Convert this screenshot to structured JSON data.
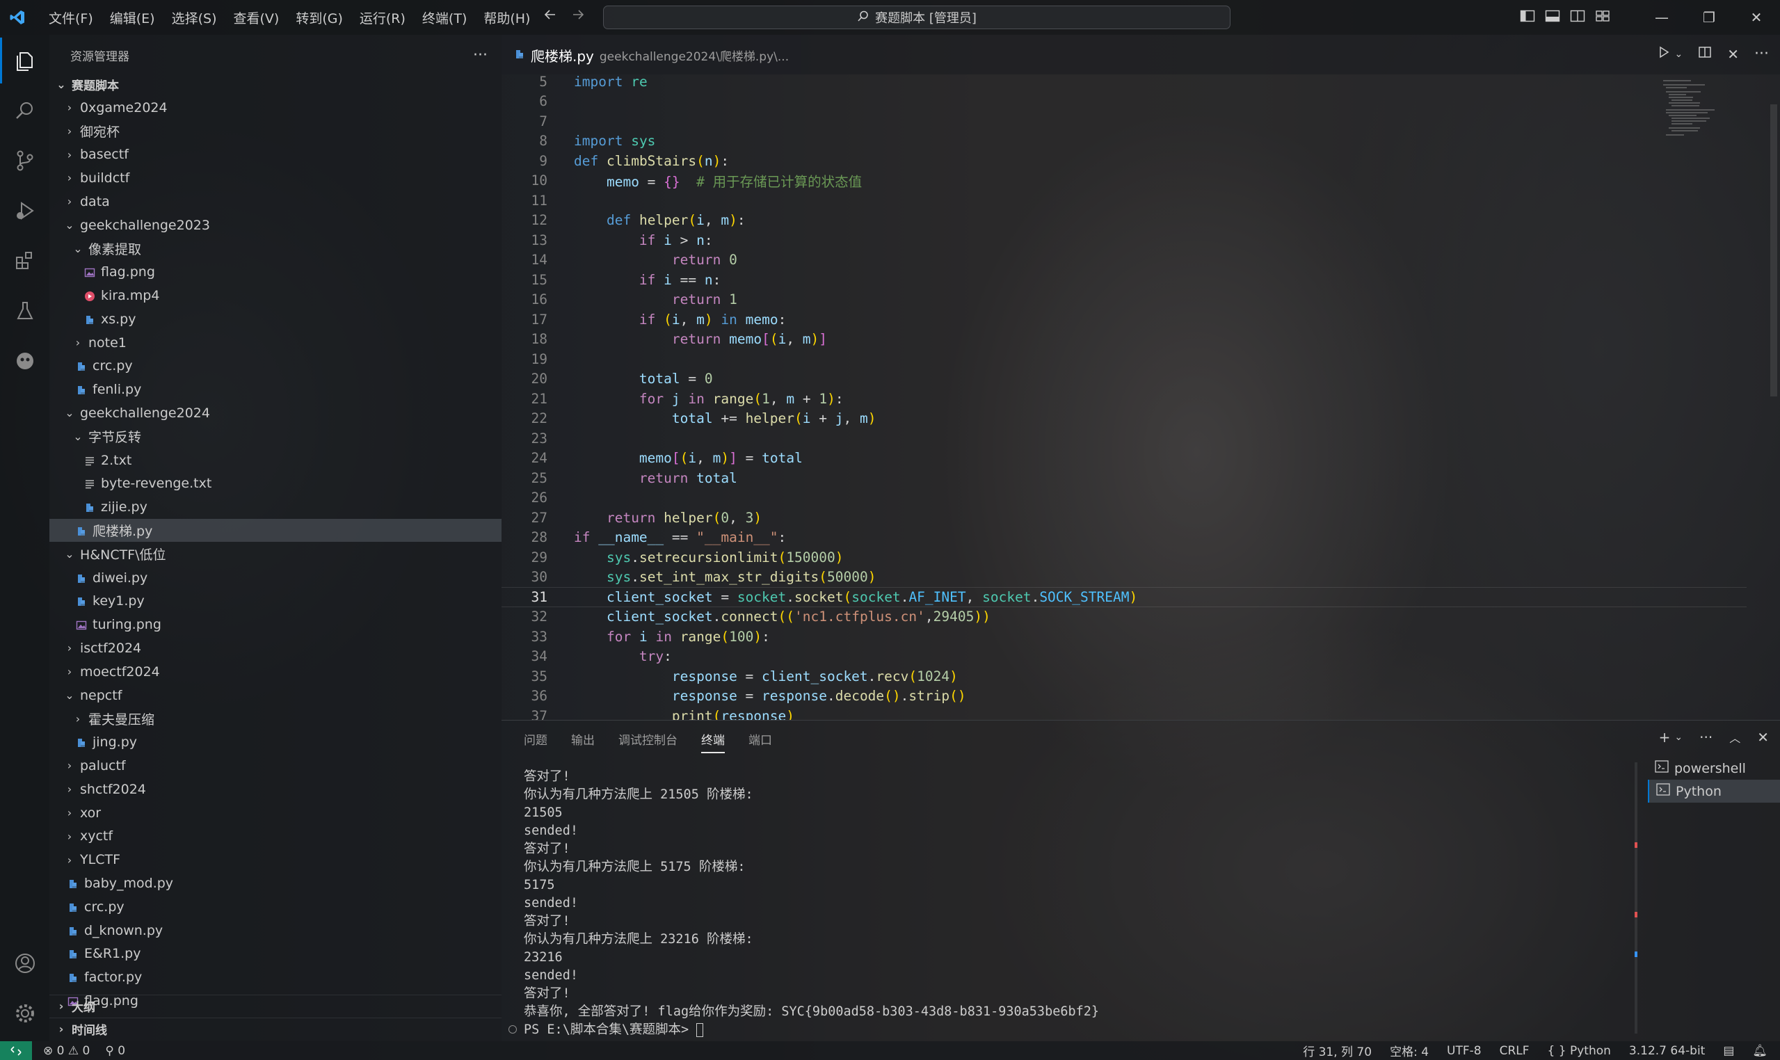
{
  "menu": [
    "文件(F)",
    "编辑(E)",
    "选择(S)",
    "查看(V)",
    "转到(G)",
    "运行(R)",
    "终端(T)",
    "帮助(H)"
  ],
  "command_center": "赛题脚本 [管理员]",
  "explorer": {
    "title": "资源管理器",
    "root": "赛题脚本",
    "rows": [
      {
        "label": "0xgame2024",
        "depth": 1,
        "kind": "folder"
      },
      {
        "label": "御宛杯",
        "depth": 1,
        "kind": "folder"
      },
      {
        "label": "basectf",
        "depth": 1,
        "kind": "folder"
      },
      {
        "label": "buildctf",
        "depth": 1,
        "kind": "folder"
      },
      {
        "label": "data",
        "depth": 1,
        "kind": "folder"
      },
      {
        "label": "geekchallenge2023",
        "depth": 1,
        "kind": "folder-open"
      },
      {
        "label": "像素提取",
        "depth": 2,
        "kind": "folder-open"
      },
      {
        "label": "flag.png",
        "depth": 3,
        "kind": "image"
      },
      {
        "label": "kira.mp4",
        "depth": 3,
        "kind": "video"
      },
      {
        "label": "xs.py",
        "depth": 3,
        "kind": "python"
      },
      {
        "label": "note1",
        "depth": 2,
        "kind": "folder"
      },
      {
        "label": "crc.py",
        "depth": 2,
        "kind": "python"
      },
      {
        "label": "fenli.py",
        "depth": 2,
        "kind": "python"
      },
      {
        "label": "geekchallenge2024",
        "depth": 1,
        "kind": "folder-open"
      },
      {
        "label": "字节反转",
        "depth": 2,
        "kind": "folder-open"
      },
      {
        "label": "2.txt",
        "depth": 3,
        "kind": "text"
      },
      {
        "label": "byte-revenge.txt",
        "depth": 3,
        "kind": "text"
      },
      {
        "label": "zijie.py",
        "depth": 3,
        "kind": "python"
      },
      {
        "label": "爬楼梯.py",
        "depth": 2,
        "kind": "python",
        "selected": true
      },
      {
        "label": "H&NCTF\\低位",
        "depth": 1,
        "kind": "folder-open"
      },
      {
        "label": "diwei.py",
        "depth": 2,
        "kind": "python"
      },
      {
        "label": "key1.py",
        "depth": 2,
        "kind": "python"
      },
      {
        "label": "turing.png",
        "depth": 2,
        "kind": "image"
      },
      {
        "label": "isctf2024",
        "depth": 1,
        "kind": "folder"
      },
      {
        "label": "moectf2024",
        "depth": 1,
        "kind": "folder"
      },
      {
        "label": "nepctf",
        "depth": 1,
        "kind": "folder-open"
      },
      {
        "label": "霍夫曼压缩",
        "depth": 2,
        "kind": "folder"
      },
      {
        "label": "jing.py",
        "depth": 2,
        "kind": "python"
      },
      {
        "label": "paluctf",
        "depth": 1,
        "kind": "folder"
      },
      {
        "label": "shctf2024",
        "depth": 1,
        "kind": "folder"
      },
      {
        "label": "xor",
        "depth": 1,
        "kind": "folder"
      },
      {
        "label": "xyctf",
        "depth": 1,
        "kind": "folder"
      },
      {
        "label": "YLCTF",
        "depth": 1,
        "kind": "folder"
      },
      {
        "label": "baby_mod.py",
        "depth": 1,
        "kind": "python"
      },
      {
        "label": "crc.py",
        "depth": 1,
        "kind": "python"
      },
      {
        "label": "d_known.py",
        "depth": 1,
        "kind": "python"
      },
      {
        "label": "E&R1.py",
        "depth": 1,
        "kind": "python"
      },
      {
        "label": "factor.py",
        "depth": 1,
        "kind": "python"
      },
      {
        "label": "flag.png",
        "depth": 1,
        "kind": "image"
      }
    ],
    "sections": [
      "大纲",
      "时间线"
    ]
  },
  "tab": {
    "name": "爬楼梯.py",
    "path": "geekchallenge2024\\爬楼梯.py\\..."
  },
  "code": {
    "current_line": 31,
    "lines": [
      {
        "n": 5,
        "t": "import re"
      },
      {
        "n": 6,
        "t": ""
      },
      {
        "n": 7,
        "t": ""
      },
      {
        "n": 8,
        "t": "import sys"
      },
      {
        "n": 9,
        "t": "def climbStairs(n):"
      },
      {
        "n": 10,
        "t": "    memo = {}  # 用于存储已计算的状态值"
      },
      {
        "n": 11,
        "t": ""
      },
      {
        "n": 12,
        "t": "    def helper(i, m):"
      },
      {
        "n": 13,
        "t": "        if i > n:"
      },
      {
        "n": 14,
        "t": "            return 0"
      },
      {
        "n": 15,
        "t": "        if i == n:"
      },
      {
        "n": 16,
        "t": "            return 1"
      },
      {
        "n": 17,
        "t": "        if (i, m) in memo:"
      },
      {
        "n": 18,
        "t": "            return memo[(i, m)]"
      },
      {
        "n": 19,
        "t": ""
      },
      {
        "n": 20,
        "t": "        total = 0"
      },
      {
        "n": 21,
        "t": "        for j in range(1, m + 1):"
      },
      {
        "n": 22,
        "t": "            total += helper(i + j, m)"
      },
      {
        "n": 23,
        "t": ""
      },
      {
        "n": 24,
        "t": "        memo[(i, m)] = total"
      },
      {
        "n": 25,
        "t": "        return total"
      },
      {
        "n": 26,
        "t": ""
      },
      {
        "n": 27,
        "t": "    return helper(0, 3)"
      },
      {
        "n": 28,
        "t": "if __name__ == \"__main__\":"
      },
      {
        "n": 29,
        "t": "    sys.setrecursionlimit(150000)"
      },
      {
        "n": 30,
        "t": "    sys.set_int_max_str_digits(50000)"
      },
      {
        "n": 31,
        "t": "    client_socket = socket.socket(socket.AF_INET, socket.SOCK_STREAM)"
      },
      {
        "n": 32,
        "t": "    client_socket.connect(('nc1.ctfplus.cn',29405))"
      },
      {
        "n": 33,
        "t": "    for i in range(100):"
      },
      {
        "n": 34,
        "t": "        try:"
      },
      {
        "n": 35,
        "t": "            response = client_socket.recv(1024)"
      },
      {
        "n": 36,
        "t": "            response = response.decode().strip()"
      },
      {
        "n": 37,
        "t": "            print(response)"
      }
    ]
  },
  "panel": {
    "tabs": [
      "问题",
      "输出",
      "调试控制台",
      "终端",
      "端口"
    ],
    "active_tab": "终端",
    "terminal_lines": [
      "答对了!",
      "你认为有几种方法爬上 21505 阶楼梯:",
      "21505",
      "sended!",
      "答对了!",
      "你认为有几种方法爬上 5175 阶楼梯:",
      "5175",
      "sended!",
      "答对了!",
      "你认为有几种方法爬上 23216 阶楼梯:",
      "23216",
      "sended!",
      "答对了!",
      "恭喜你, 全部答对了! flag给你作为奖励: SYC{9b00ad58-b303-43d8-b831-930a53be6bf2}"
    ],
    "prompt": "PS E:\\脚本合集\\赛题脚本> ",
    "terminals": [
      "powershell",
      "Python"
    ],
    "active_terminal": "Python"
  },
  "status": {
    "errors": "0",
    "warnings": "0",
    "ports": "0",
    "position": "行 31, 列 70",
    "spaces": "空格: 4",
    "encoding": "UTF-8",
    "eol": "CRLF",
    "language": "Python",
    "interpreter": "3.12.7 64-bit"
  },
  "colors": {
    "accent": "#0078d4",
    "remote": "#16825d"
  }
}
